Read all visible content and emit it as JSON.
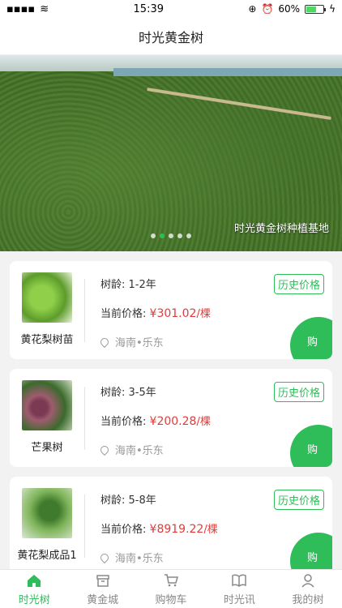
{
  "status": {
    "time": "15:39",
    "battery": "60%",
    "battery_level": 0.6
  },
  "nav": {
    "title": "时光黄金树"
  },
  "banner": {
    "caption": "时光黄金树种植基地",
    "dots": 5,
    "active_dot": 1
  },
  "products": [
    {
      "name": "黄花梨树苗",
      "age": "树龄: 1-2年",
      "price_label": "当前价格:",
      "price": "¥301.02",
      "unit": "/棵",
      "location": "海南•乐东",
      "history": "历史价格",
      "buy": "购"
    },
    {
      "name": "芒果树",
      "age": "树龄: 3-5年",
      "price_label": "当前价格:",
      "price": "¥200.28",
      "unit": "/棵",
      "location": "海南•乐东",
      "history": "历史价格",
      "buy": "购"
    },
    {
      "name": "黄花梨成品1",
      "age": "树龄: 5-8年",
      "price_label": "当前价格:",
      "price": "¥8919.22",
      "unit": "/棵",
      "location": "海南•乐东",
      "history": "历史价格",
      "buy": "购"
    }
  ],
  "tabs": [
    {
      "label": "时光树",
      "icon": "home-icon",
      "active": true
    },
    {
      "label": "黄金城",
      "icon": "store-icon",
      "active": false
    },
    {
      "label": "购物车",
      "icon": "cart-icon",
      "active": false
    },
    {
      "label": "时光讯",
      "icon": "book-icon",
      "active": false
    },
    {
      "label": "我的树",
      "icon": "user-icon",
      "active": false
    }
  ],
  "colors": {
    "accent": "#2ebd59",
    "price": "#e23b3b"
  }
}
